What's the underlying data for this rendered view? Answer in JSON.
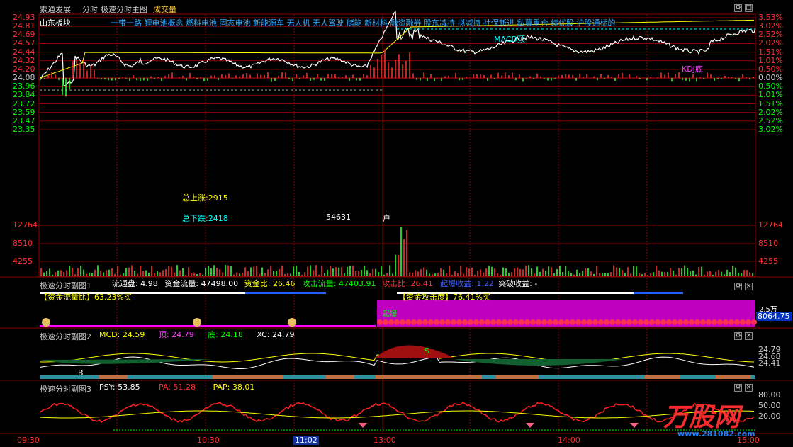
{
  "header": {
    "stock_name": "索通发展",
    "mode": "分时",
    "chart_name": "极速分时主图",
    "volume_label": "成交量",
    "sector_label": "山东板块",
    "concepts": "一带一路 锂电池概念 燃料电池 固态电池 新能源车 无人机 无人驾驶 储能 新材料 融资融券 股东减持 拟减持 社保新进 私募重仓 绩优股 沪股通标的"
  },
  "main_chart": {
    "price_labels": [
      "24.93",
      "24.81",
      "24.69",
      "24.57",
      "24.44",
      "24.32",
      "24.20",
      "24.08",
      "23.96",
      "23.84",
      "23.72",
      "23.59",
      "23.47",
      "23.35"
    ],
    "pct_labels": [
      "3.53%",
      "3.02%",
      "2.52%",
      "2.02%",
      "1.51%",
      "1.01%",
      "0.50%",
      "0.00%",
      "0.50%",
      "1.01%",
      "1.51%",
      "2.02%",
      "2.52%",
      "3.02%"
    ],
    "base_price_label": "24.08",
    "total_up_label": "总上涨:2915",
    "total_down_label": "总下跌:2418",
    "hu_value": "54631",
    "hu_label": "户",
    "macd_top_label": "MACD顶",
    "kdj_bottom_label": "KDJ底",
    "colors": {
      "price_line": "#ffffff",
      "avg_line": "#ffff00",
      "up": "#ff3333",
      "down": "#33ff33",
      "grid": "#8b0000",
      "cyan": "#00ffff"
    }
  },
  "volume_chart": {
    "labels": [
      "12764",
      "8510",
      "4255"
    ]
  },
  "sub1": {
    "title": "极速分时副图1",
    "items": [
      {
        "label": "流通盘: 4.98",
        "color": "#ffffff"
      },
      {
        "label": "资金流量: 47498.00",
        "color": "#ffffff"
      },
      {
        "label": "资金比: 26.46",
        "color": "#ffff00"
      },
      {
        "label": "攻击流量: 47403.91",
        "color": "#00ff00"
      },
      {
        "label": "攻击比: 26.41",
        "color": "#ff3030"
      },
      {
        "label": "起爆收益: 1.22",
        "color": "#4060ff"
      },
      {
        "label": "突破收益: -",
        "color": "#ffffff"
      }
    ],
    "flow_ratio_label": "【资金流量比】63.23%买",
    "attack_label": "【资金攻击度】76.41%买",
    "qibao_label": "起爆",
    "right_label": "8064.75",
    "unit_label": "2.5万"
  },
  "sub2": {
    "title": "极速分时副图2",
    "items": [
      {
        "label": "MCD: 24.59",
        "color": "#ffff00"
      },
      {
        "label": "顶: 24.79",
        "color": "#ff40ff"
      },
      {
        "label": "底: 24.18",
        "color": "#00ff00"
      },
      {
        "label": "XC: 24.79",
        "color": "#ffffff"
      }
    ],
    "right_labels": [
      "24.79",
      "24.68",
      "24.41"
    ],
    "b_marker": "B",
    "s_marker": "S"
  },
  "sub3": {
    "title": "极速分时副图3",
    "items": [
      {
        "label": "PSY: 53.85",
        "color": "#ffffff"
      },
      {
        "label": "PA: 51.28",
        "color": "#ff3030"
      },
      {
        "label": "PAP: 38.01",
        "color": "#ffff00"
      }
    ],
    "right_labels": [
      "80.00",
      "50.00",
      "20.00"
    ]
  },
  "time_axis": {
    "labels": [
      "09:30",
      "10:30",
      "11:02",
      "13:00",
      "14:00",
      "15:00"
    ],
    "highlight": "11:02"
  },
  "watermark": {
    "brand": "万股网",
    "site": "www.281082.com"
  }
}
